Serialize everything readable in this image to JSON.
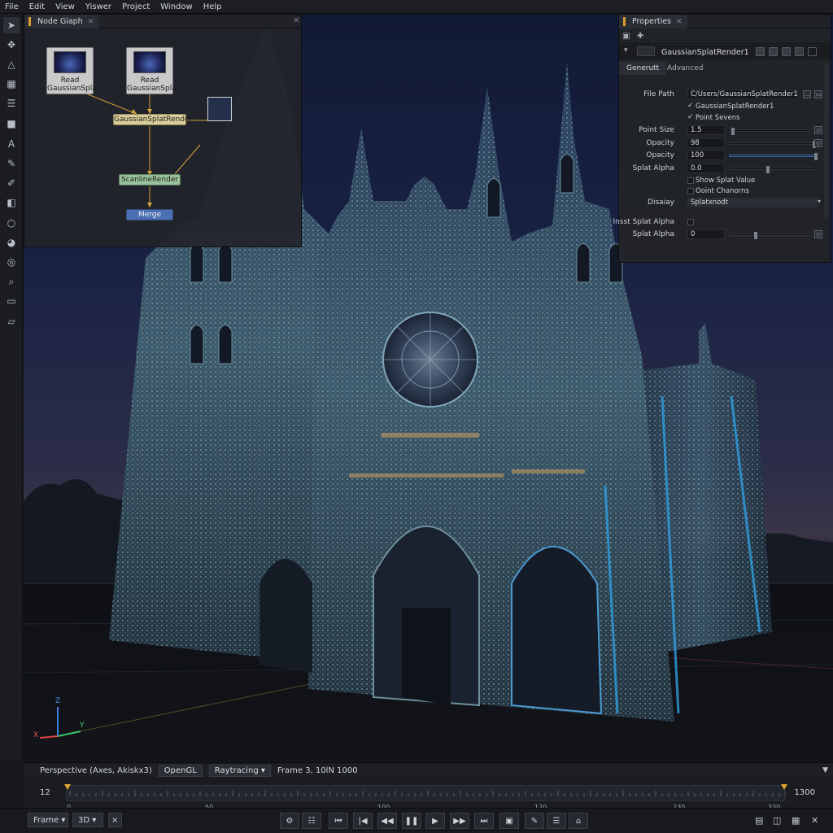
{
  "menu": [
    "File",
    "Edit",
    "View",
    "Yiswer",
    "Project",
    "Window",
    "Help"
  ],
  "toolbar": {
    "icons": [
      "cursor-icon",
      "transform-icon",
      "measure-icon",
      "grid-icon",
      "list-icon",
      "cube-icon",
      "text-icon",
      "brush-icon",
      "paint-icon",
      "camera-icon",
      "circle-icon",
      "palette-icon",
      "compass-icon",
      "zoom-icon",
      "image-icon",
      "folder-icon"
    ]
  },
  "node_graph": {
    "tab_label": "Node Giaph",
    "nodes": {
      "read1": {
        "line1": "Read",
        "line2": "GaussianSplat"
      },
      "read2": {
        "line1": "Read",
        "line2": "GaussianSplat"
      },
      "splat_render": "GaussianSplatRender",
      "scanline_render": "ScanlineRender",
      "merge": "Merge"
    }
  },
  "properties": {
    "tab_label": "Properties",
    "node_name": "GaussianSplatRender1",
    "tabs": [
      "Generutt",
      "Advanced"
    ],
    "rows": [
      {
        "label": "File Path",
        "value": "C/Users/GaussianSplatRender1"
      },
      {
        "label": "",
        "check": "✓",
        "text": "GaussianSplatRender1"
      },
      {
        "label": "",
        "check": "✓",
        "text": "Point Sevens"
      },
      {
        "label": "Point Size",
        "value": "1.5"
      },
      {
        "label": "Opacity",
        "value": "98"
      },
      {
        "label": "Opacity",
        "value": "100"
      },
      {
        "label": "Splat Alpha",
        "value": "0.0"
      },
      {
        "label": "",
        "text": "Show Splat Value"
      },
      {
        "label": "",
        "text": "Ooint Chanorns"
      },
      {
        "label": "Disaiay",
        "value": "Splatxnodt"
      },
      {
        "label": "Insst Splat Alpha",
        "text": ""
      },
      {
        "label": "Splat Alpha",
        "value": "0"
      }
    ],
    "point_size_level": 0.02,
    "opacity_level_1": 0.98,
    "opacity_level_2": 1.0,
    "splat_alpha_level": 0.0
  },
  "status_bar": {
    "view_label": "Perspective (Axes, Akiskx3)",
    "renderer_1": "OpenGL",
    "renderer_2": "Raytracing",
    "frame_info": "Frame 3, 10lN 1000"
  },
  "axes": {
    "z": "Z",
    "y": "Y",
    "x": "X"
  },
  "timeline": {
    "start": "12",
    "end": "1300",
    "ticks": [
      "0",
      "50",
      "100",
      "120",
      "230",
      "330"
    ]
  },
  "controls": {
    "mode": "Frame",
    "dim": "3D",
    "close": "×"
  },
  "colors": {
    "accent": "#d89b2c",
    "merge_node": "#4b6fb0",
    "scanline_node": "#9ac29a",
    "splat_node": "#d9cd99",
    "sky_top": "#111a35"
  }
}
